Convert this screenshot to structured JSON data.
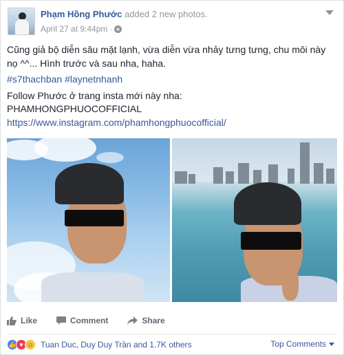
{
  "post": {
    "author": "Phạm Hồng Phước",
    "action": "added 2 new photos.",
    "timestamp": "April 27 at 9:44pm",
    "separator": "·",
    "privacy_icon": "globe-icon",
    "options_icon": "chevron-down-icon",
    "text": {
      "line1": "Cũng giả bộ diễn sâu mặt lạnh, vừa diễn vừa nhảy tưng tưng, chu môi này nọ ^^... Hình trước và sau nha, haha.",
      "hashtags": "#s7thachban #laynetnhanh",
      "follow": "Follow Phước ở trang insta mới này nha:",
      "handle": "PHAMHONGPHUOCOFFICIAL",
      "url": "https://www.instagram.com/phamhongphuocofficial/"
    },
    "photos": [
      {
        "description_icon": "photo-selfie-sky"
      },
      {
        "description_icon": "photo-selfie-beach"
      }
    ]
  },
  "actions": {
    "like": "Like",
    "comment": "Comment",
    "share": "Share"
  },
  "reactions": {
    "icons": [
      "like-icon",
      "love-icon",
      "haha-icon"
    ],
    "summary": "Tuan Duc, Duy Duy Trần and 1.7K others",
    "sort_label": "Top Comments"
  },
  "colors": {
    "link": "#365899",
    "meta": "#90949c",
    "like": "#4f7ff0",
    "love": "#f0395b",
    "haha": "#f7c549"
  }
}
